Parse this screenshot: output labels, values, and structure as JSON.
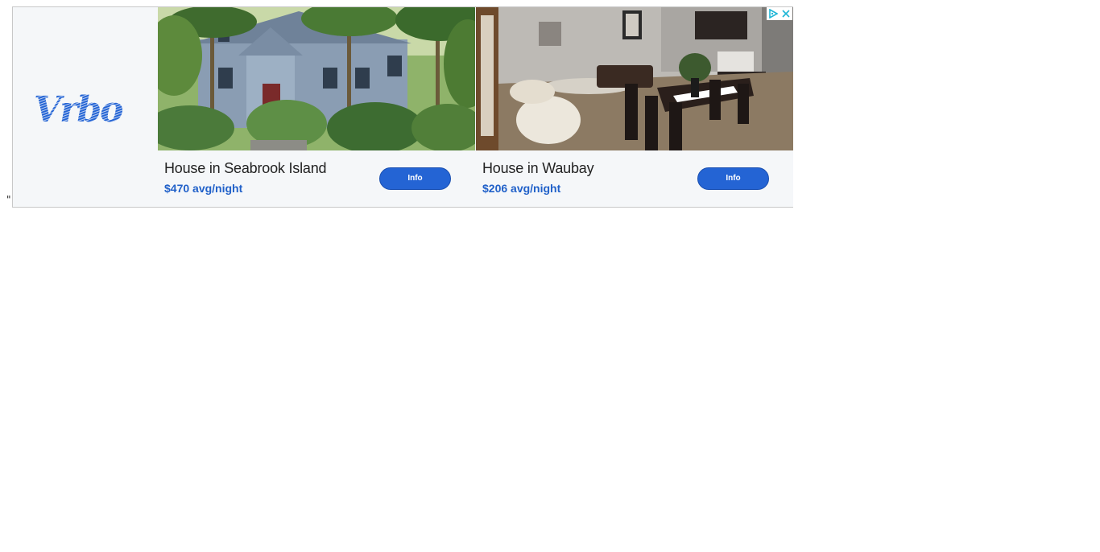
{
  "stray_text": "\"",
  "brand": {
    "logo_text": "Vrbo",
    "accent_color": "#2464d4"
  },
  "listings": [
    {
      "title": "House in Seabrook Island",
      "price": "$470 avg/night",
      "button_label": "Info",
      "photo": "house-exterior-palm-trees"
    },
    {
      "title": "House in Waubay",
      "price": "$206 avg/night",
      "button_label": "Info",
      "photo": "living-room-dining-kitchen"
    }
  ],
  "ad_controls": {
    "adchoices_icon": "adchoices-icon",
    "close_icon": "close-icon"
  }
}
